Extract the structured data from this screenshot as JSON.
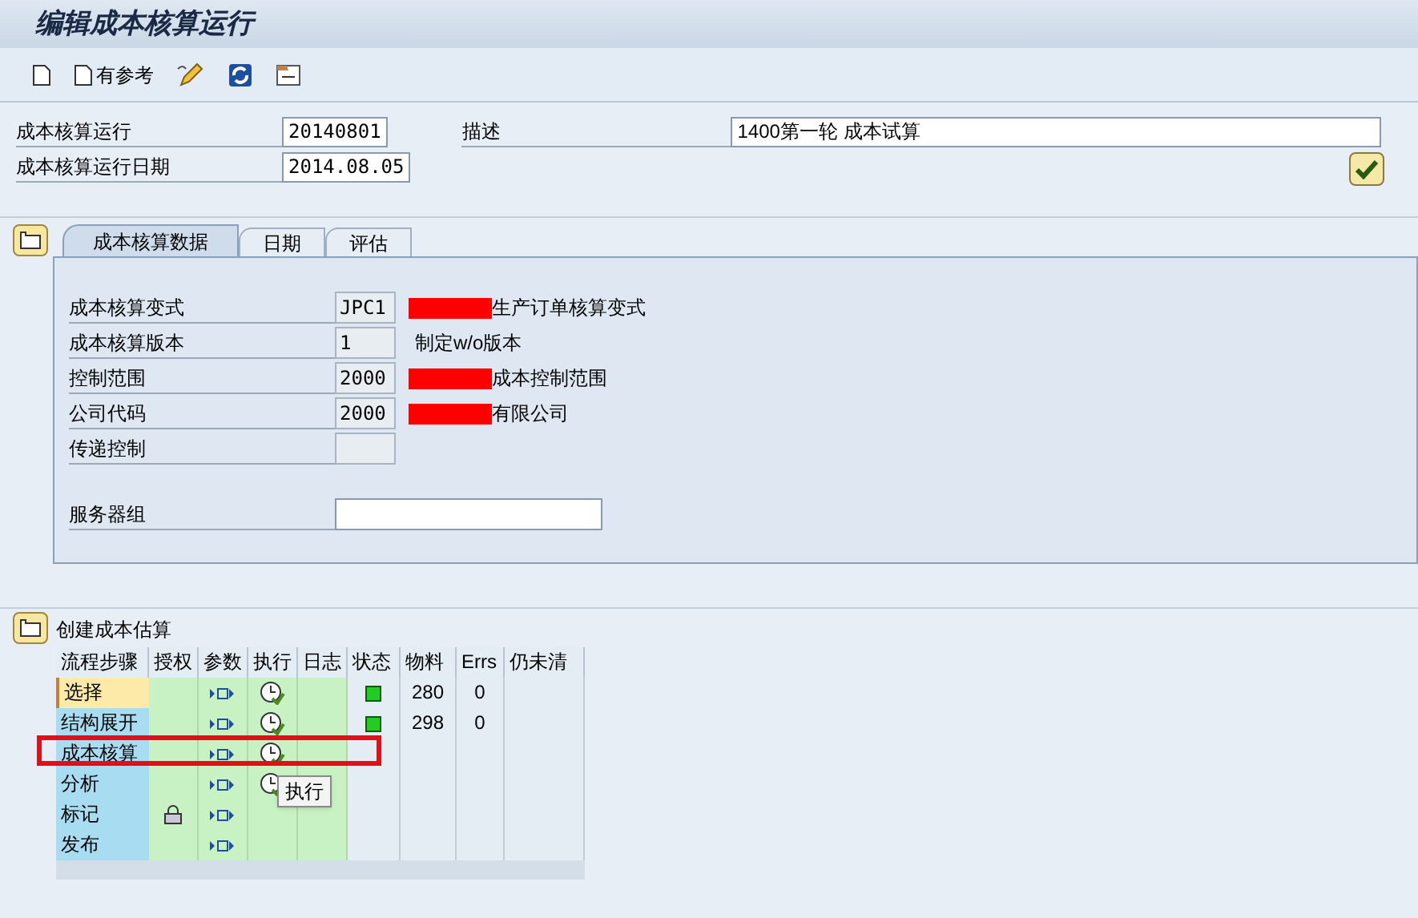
{
  "title": "编辑成本核算运行",
  "toolbar": [
    {
      "kind": "new"
    },
    {
      "kind": "new",
      "label": "有参考"
    },
    {
      "kind": "edit"
    },
    {
      "kind": "refresh"
    },
    {
      "kind": "info"
    }
  ],
  "header": {
    "fields": [
      {
        "label": "成本核算运行",
        "value": "20140801"
      },
      {
        "label": "成本核算运行日期",
        "value": "2014.08.05"
      }
    ],
    "description": {
      "label": "描述",
      "value": "1400第一轮 成本试算"
    }
  },
  "tabs": [
    {
      "label": "成本核算数据",
      "selected": true
    },
    {
      "label": "日期",
      "selected": false
    },
    {
      "label": "评估",
      "selected": false
    }
  ],
  "tab_fields": [
    {
      "label": "成本核算变式",
      "value": "JPC1",
      "text": "生产订单核算变式",
      "redacted": true
    },
    {
      "label": "成本核算版本",
      "value": "1",
      "text": "制定w/o版本",
      "redacted": false
    },
    {
      "label": "控制范围",
      "value": "2000",
      "text": "成本控制范围",
      "redacted": true
    },
    {
      "label": "公司代码",
      "value": "2000",
      "text": "有限公司",
      "redacted": true
    },
    {
      "label": "传递控制",
      "redacted": false
    }
  ],
  "server_group": {
    "label": "服务器组"
  },
  "process": {
    "title": "创建成本估算",
    "columns": [
      "流程步骤",
      "授权",
      "参数",
      "执行",
      "日志",
      "状态",
      "物料",
      "Errs",
      "仍未清"
    ],
    "rows": [
      {
        "step": "选择",
        "focused": true,
        "locked": false,
        "execute": true,
        "status_done": true,
        "materials": "280",
        "errs": "0",
        "marked": false
      },
      {
        "step": "结构展开",
        "focused": false,
        "locked": false,
        "execute": true,
        "status_done": true,
        "materials": "298",
        "errs": "0",
        "marked": false
      },
      {
        "step": "成本核算",
        "focused": false,
        "locked": false,
        "execute": true,
        "status_done": false,
        "marked": true
      },
      {
        "step": "分析",
        "focused": false,
        "locked": false,
        "execute": true,
        "status_done": false,
        "marked": false,
        "tooltip": "执行"
      },
      {
        "step": "标记",
        "focused": false,
        "locked": true,
        "execute": false,
        "status_done": false,
        "marked": false
      },
      {
        "step": "发布",
        "focused": false,
        "locked": false,
        "execute": false,
        "status_done": false,
        "marked": false
      }
    ]
  }
}
